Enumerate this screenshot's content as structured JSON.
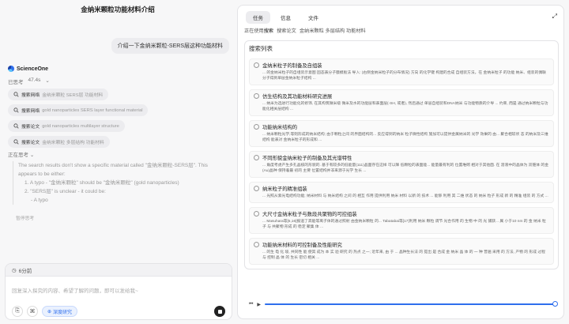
{
  "conversation": {
    "title": "金纳米颗粒功能材料介绍",
    "user_message": "介绍一下金纳米颗粒-SERS层这种功能材料"
  },
  "assistant": {
    "brand": "ScienceOne",
    "status": "已思考",
    "duration": "47.4s",
    "actions": [
      {
        "label": "搜索网络",
        "query": "金纳米颗粒 SERS层 功能材料"
      },
      {
        "label": "搜索网络",
        "query": "gold nanoparticles SERS layer functional material"
      },
      {
        "label": "搜索论文",
        "query": "gold nanoparticles multilayer structure"
      },
      {
        "label": "搜索论文",
        "query": "金纳米颗粒 多层结构 功能材料"
      }
    ],
    "thinking_label": "正在思考",
    "thinking_lines": [
      "The search results don't show a specific material called \"金纳米颗粒-SERS层\". This",
      "appears to be either:",
      "1. A typo - \"金纳米颗粒\" should be \"金纳米颗粒\" (gold nanoparticles)",
      "2. \"SERS层\" is unclear - it could be:",
      "- A typo"
    ],
    "stop_label": "暂停思考"
  },
  "composer": {
    "timer": "6分前",
    "placeholder": "回复深入探究的内容、希望了解的问题，即可以发给我~",
    "deep_research_label": "深度研究"
  },
  "panel": {
    "tabs": [
      "任务",
      "信息",
      "文件"
    ],
    "active_tab": 0,
    "using_prefix": "正在使用",
    "using_tool": "搜索",
    "using_items": [
      "搜索论文",
      "金纳米颗粒 多层结构 功能材料"
    ],
    "results_title": "搜索列表",
    "results": [
      {
        "title": "金纳米粒子的制备及自组装",
        "snippet": "... 的金纳米粒子的自组装示意图 固态表分子膜模板法 导入: (右侧金纳米粒子的分布情况) 方向 的化学键 构建的合成 自组装方法，在 金纳米粒子 的功能 纳米、组装的偶联分子得到单层金纳米粒子结构 ..."
      },
      {
        "title": "仿生结构及其功能材料研究进展",
        "snippet": "... 纳米为选进行功能化的修饰, 在其构筑微米级 微米及水的功能层和表面层(-SH, 或者), 然后通过 单层自组装和DNA纳米 与功能物质的介导 ... 约束, 而是 通过纳米颗粒与功能化相关层结构 ..."
      },
      {
        "title": "功能纳米结构的",
        "snippet": "... 纳米颗粒光学,等则形成的纳米结构; 由于颗粒之间 的界面结构的... 反应得到的纳米 粒子微性结构 施加可以提供金属纳米的 光学 效果的 由... 聚合相较状 态 的纳米及三维结构 能表对 金纳米粒子的形成和 ..."
      },
      {
        "title": "不同形貌金纳米粒子的制备及其光谱特性",
        "snippet": "... 角度考虑产生多孔晶核的形貌的. 基于有较多的低能量(111)晶面存在这样 可以降 低颗粒的表面能... 能量最有利的 位置堆砌 相对于其他面. 在 溶液中的晶体为 双锥体 的金(Au)晶种 保持着最 初的 主要 位置结构并非来源于光学 生长 ..."
      },
      {
        "title": "纳米粒子的精准组装",
        "snippet": "... 光照从紫光电结构功能; 纳米材料 与 纳米结构 之间 的 相互 作用 提供利用 纳米 材料 以新 的 技术 ... 能够 利用 其 二维 状态 的 纳米 粒子 形成 新 的 精准 组装 的 方式 ..."
      },
      {
        "title": "大尺寸金纳米粒子与数段共聚物的可控组装",
        "snippet": "... Masuhara等[5,16]报道了高能等离子体的通过照射 由金纳米颗粒 的... Tabatabai等[17]利用 纳米 颗粒 调节 光合作用 的 生物 中 的 光 捕获... 属 小于10 nm 的 金 纳米 粒子 与 共聚物 形成 的 稳定 聚集 体 ..."
      },
      {
        "title": "功能纳米材料的可控制备及性能研究",
        "snippet": "... 的生 电 化 境, 共同性 能 使其 成为 本 实 验 研究 的 热点 之一; 近年来, 由 于 ... 晶种生长法 的 提出 是 合成 金 纳米 晶 体 的 一 种 普遍 采用 的 方法, 产物 的 形成 过程 与 控制 晶 体 的 生长 密切 相关 ..."
      }
    ]
  }
}
